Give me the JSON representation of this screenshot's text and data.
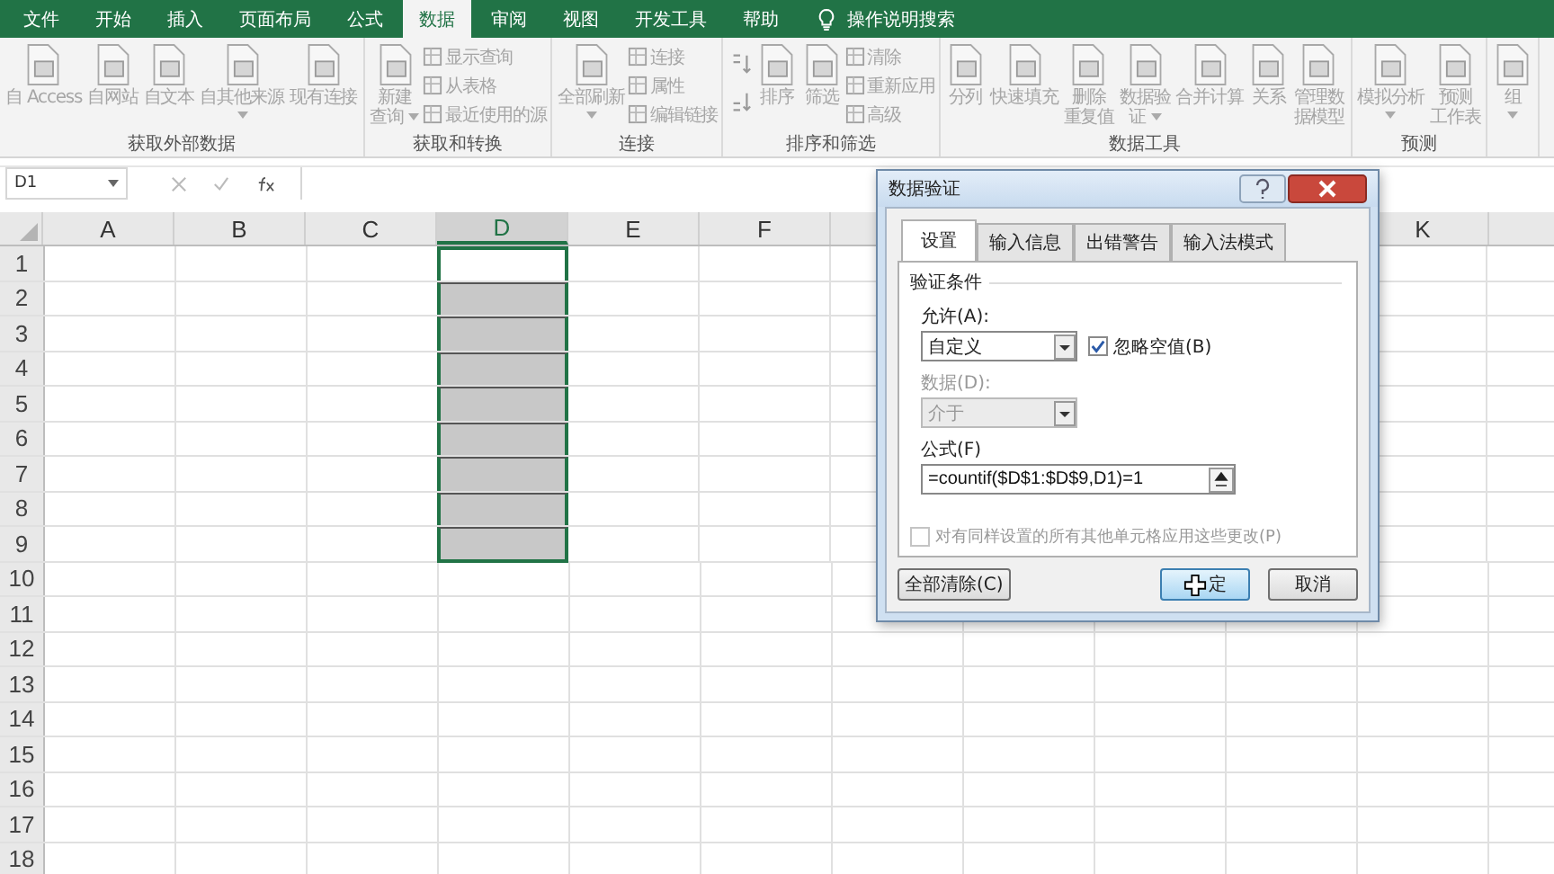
{
  "menu_tabs": [
    {
      "label": "文件",
      "selected": false
    },
    {
      "label": "开始",
      "selected": false
    },
    {
      "label": "插入",
      "selected": false
    },
    {
      "label": "页面布局",
      "selected": false
    },
    {
      "label": "公式",
      "selected": false
    },
    {
      "label": "数据",
      "selected": true
    },
    {
      "label": "审阅",
      "selected": false
    },
    {
      "label": "视图",
      "selected": false
    },
    {
      "label": "开发工具",
      "selected": false
    },
    {
      "label": "帮助",
      "selected": false
    }
  ],
  "tell_me": {
    "placeholder": "操作说明搜索"
  },
  "ribbon_groups": [
    {
      "label": "获取外部数据",
      "items": [
        {
          "kind": "large",
          "lines": [
            "自 Access"
          ]
        },
        {
          "kind": "large",
          "lines": [
            "自网站"
          ]
        },
        {
          "kind": "large",
          "lines": [
            "自文本"
          ]
        },
        {
          "kind": "large",
          "lines": [
            "自其他来源"
          ],
          "dropdown": true
        },
        {
          "kind": "large",
          "lines": [
            "现有连接"
          ]
        }
      ]
    },
    {
      "label": "获取和转换",
      "items": [
        {
          "kind": "large",
          "lines": [
            "新建",
            "查询"
          ],
          "dropdown": true
        },
        {
          "kind": "stack",
          "items": [
            "显示查询",
            "从表格",
            "最近使用的源"
          ]
        }
      ]
    },
    {
      "label": "连接",
      "items": [
        {
          "kind": "large",
          "lines": [
            "全部刷新"
          ],
          "dropdown": true
        },
        {
          "kind": "stack",
          "items": [
            "连接",
            "属性",
            "编辑链接"
          ]
        }
      ]
    },
    {
      "label": "排序和筛选",
      "items": [
        {
          "kind": "sort"
        },
        {
          "kind": "large",
          "lines": [
            "排序"
          ]
        },
        {
          "kind": "large",
          "lines": [
            "筛选"
          ]
        },
        {
          "kind": "stack",
          "items": [
            "清除",
            "重新应用",
            "高级"
          ]
        }
      ]
    },
    {
      "label": "数据工具",
      "items": [
        {
          "kind": "large",
          "lines": [
            "分列"
          ]
        },
        {
          "kind": "large",
          "lines": [
            "快速填充"
          ]
        },
        {
          "kind": "large",
          "lines": [
            "删除",
            "重复值"
          ]
        },
        {
          "kind": "large",
          "lines": [
            "数据验",
            "证"
          ],
          "dropdown": true
        },
        {
          "kind": "large",
          "lines": [
            "合并计算"
          ]
        },
        {
          "kind": "large",
          "lines": [
            "关系"
          ]
        },
        {
          "kind": "large",
          "lines": [
            "管理数",
            "据模型"
          ]
        }
      ]
    },
    {
      "label": "预测",
      "items": [
        {
          "kind": "large",
          "lines": [
            "模拟分析"
          ],
          "dropdown": true
        },
        {
          "kind": "large",
          "lines": [
            "预测",
            "工作表"
          ]
        }
      ]
    },
    {
      "items": [
        {
          "kind": "large",
          "lines": [
            "组"
          ],
          "dropdown": true
        }
      ]
    }
  ],
  "name_box": "D1",
  "sheet": {
    "columns": [
      {
        "label": "A",
        "selected": false
      },
      {
        "label": "B",
        "selected": false
      },
      {
        "label": "C",
        "selected": false
      },
      {
        "label": "D",
        "selected": true
      },
      {
        "label": "E",
        "selected": false
      },
      {
        "label": "F",
        "selected": false
      },
      {
        "label": "K",
        "selected": false
      }
    ],
    "rows": [
      {
        "label": "1",
        "selected": true,
        "shaded": false
      },
      {
        "label": "2",
        "selected": true,
        "shaded": true
      },
      {
        "label": "3",
        "selected": true,
        "shaded": true
      },
      {
        "label": "4",
        "selected": true,
        "shaded": true
      },
      {
        "label": "5",
        "selected": true,
        "shaded": true
      },
      {
        "label": "6",
        "selected": true,
        "shaded": true
      },
      {
        "label": "7",
        "selected": true,
        "shaded": true
      },
      {
        "label": "8",
        "selected": true,
        "shaded": true
      },
      {
        "label": "9",
        "selected": true,
        "shaded": true
      },
      {
        "label": "10",
        "selected": false,
        "shaded": false
      },
      {
        "label": "11",
        "selected": false,
        "shaded": false
      },
      {
        "label": "12",
        "selected": false,
        "shaded": false
      },
      {
        "label": "13",
        "selected": false,
        "shaded": false
      },
      {
        "label": "14",
        "selected": false,
        "shaded": false
      },
      {
        "label": "15",
        "selected": false,
        "shaded": false
      },
      {
        "label": "16",
        "selected": false,
        "shaded": false
      },
      {
        "label": "17",
        "selected": false,
        "shaded": false
      },
      {
        "label": "18",
        "selected": false,
        "shaded": false
      }
    ]
  },
  "dialog": {
    "title": "数据验证",
    "tabs": [
      {
        "label": "设置",
        "selected": true
      },
      {
        "label": "输入信息",
        "selected": false
      },
      {
        "label": "出错警告",
        "selected": false
      },
      {
        "label": "输入法模式",
        "selected": false
      }
    ],
    "section": "验证条件",
    "allow_label": "允许(A):",
    "allow_value": "自定义",
    "ignore_blank": {
      "label": "忽略空值(B)",
      "checked": true
    },
    "data_label": "数据(D):",
    "data_value": "介于",
    "data_disabled": true,
    "formula_label": "公式(F)",
    "formula_value": "=countif($D$1:$D$9,D1)=1",
    "apply_all": {
      "label": "对有同样设置的所有其他单元格应用这些更改(P)",
      "checked": false,
      "disabled": true
    },
    "buttons": [
      {
        "label": "全部清除(C)",
        "kind": "clear"
      },
      {
        "label": "定",
        "kind": "ok"
      },
      {
        "label": "取消",
        "kind": "cancel"
      }
    ]
  }
}
